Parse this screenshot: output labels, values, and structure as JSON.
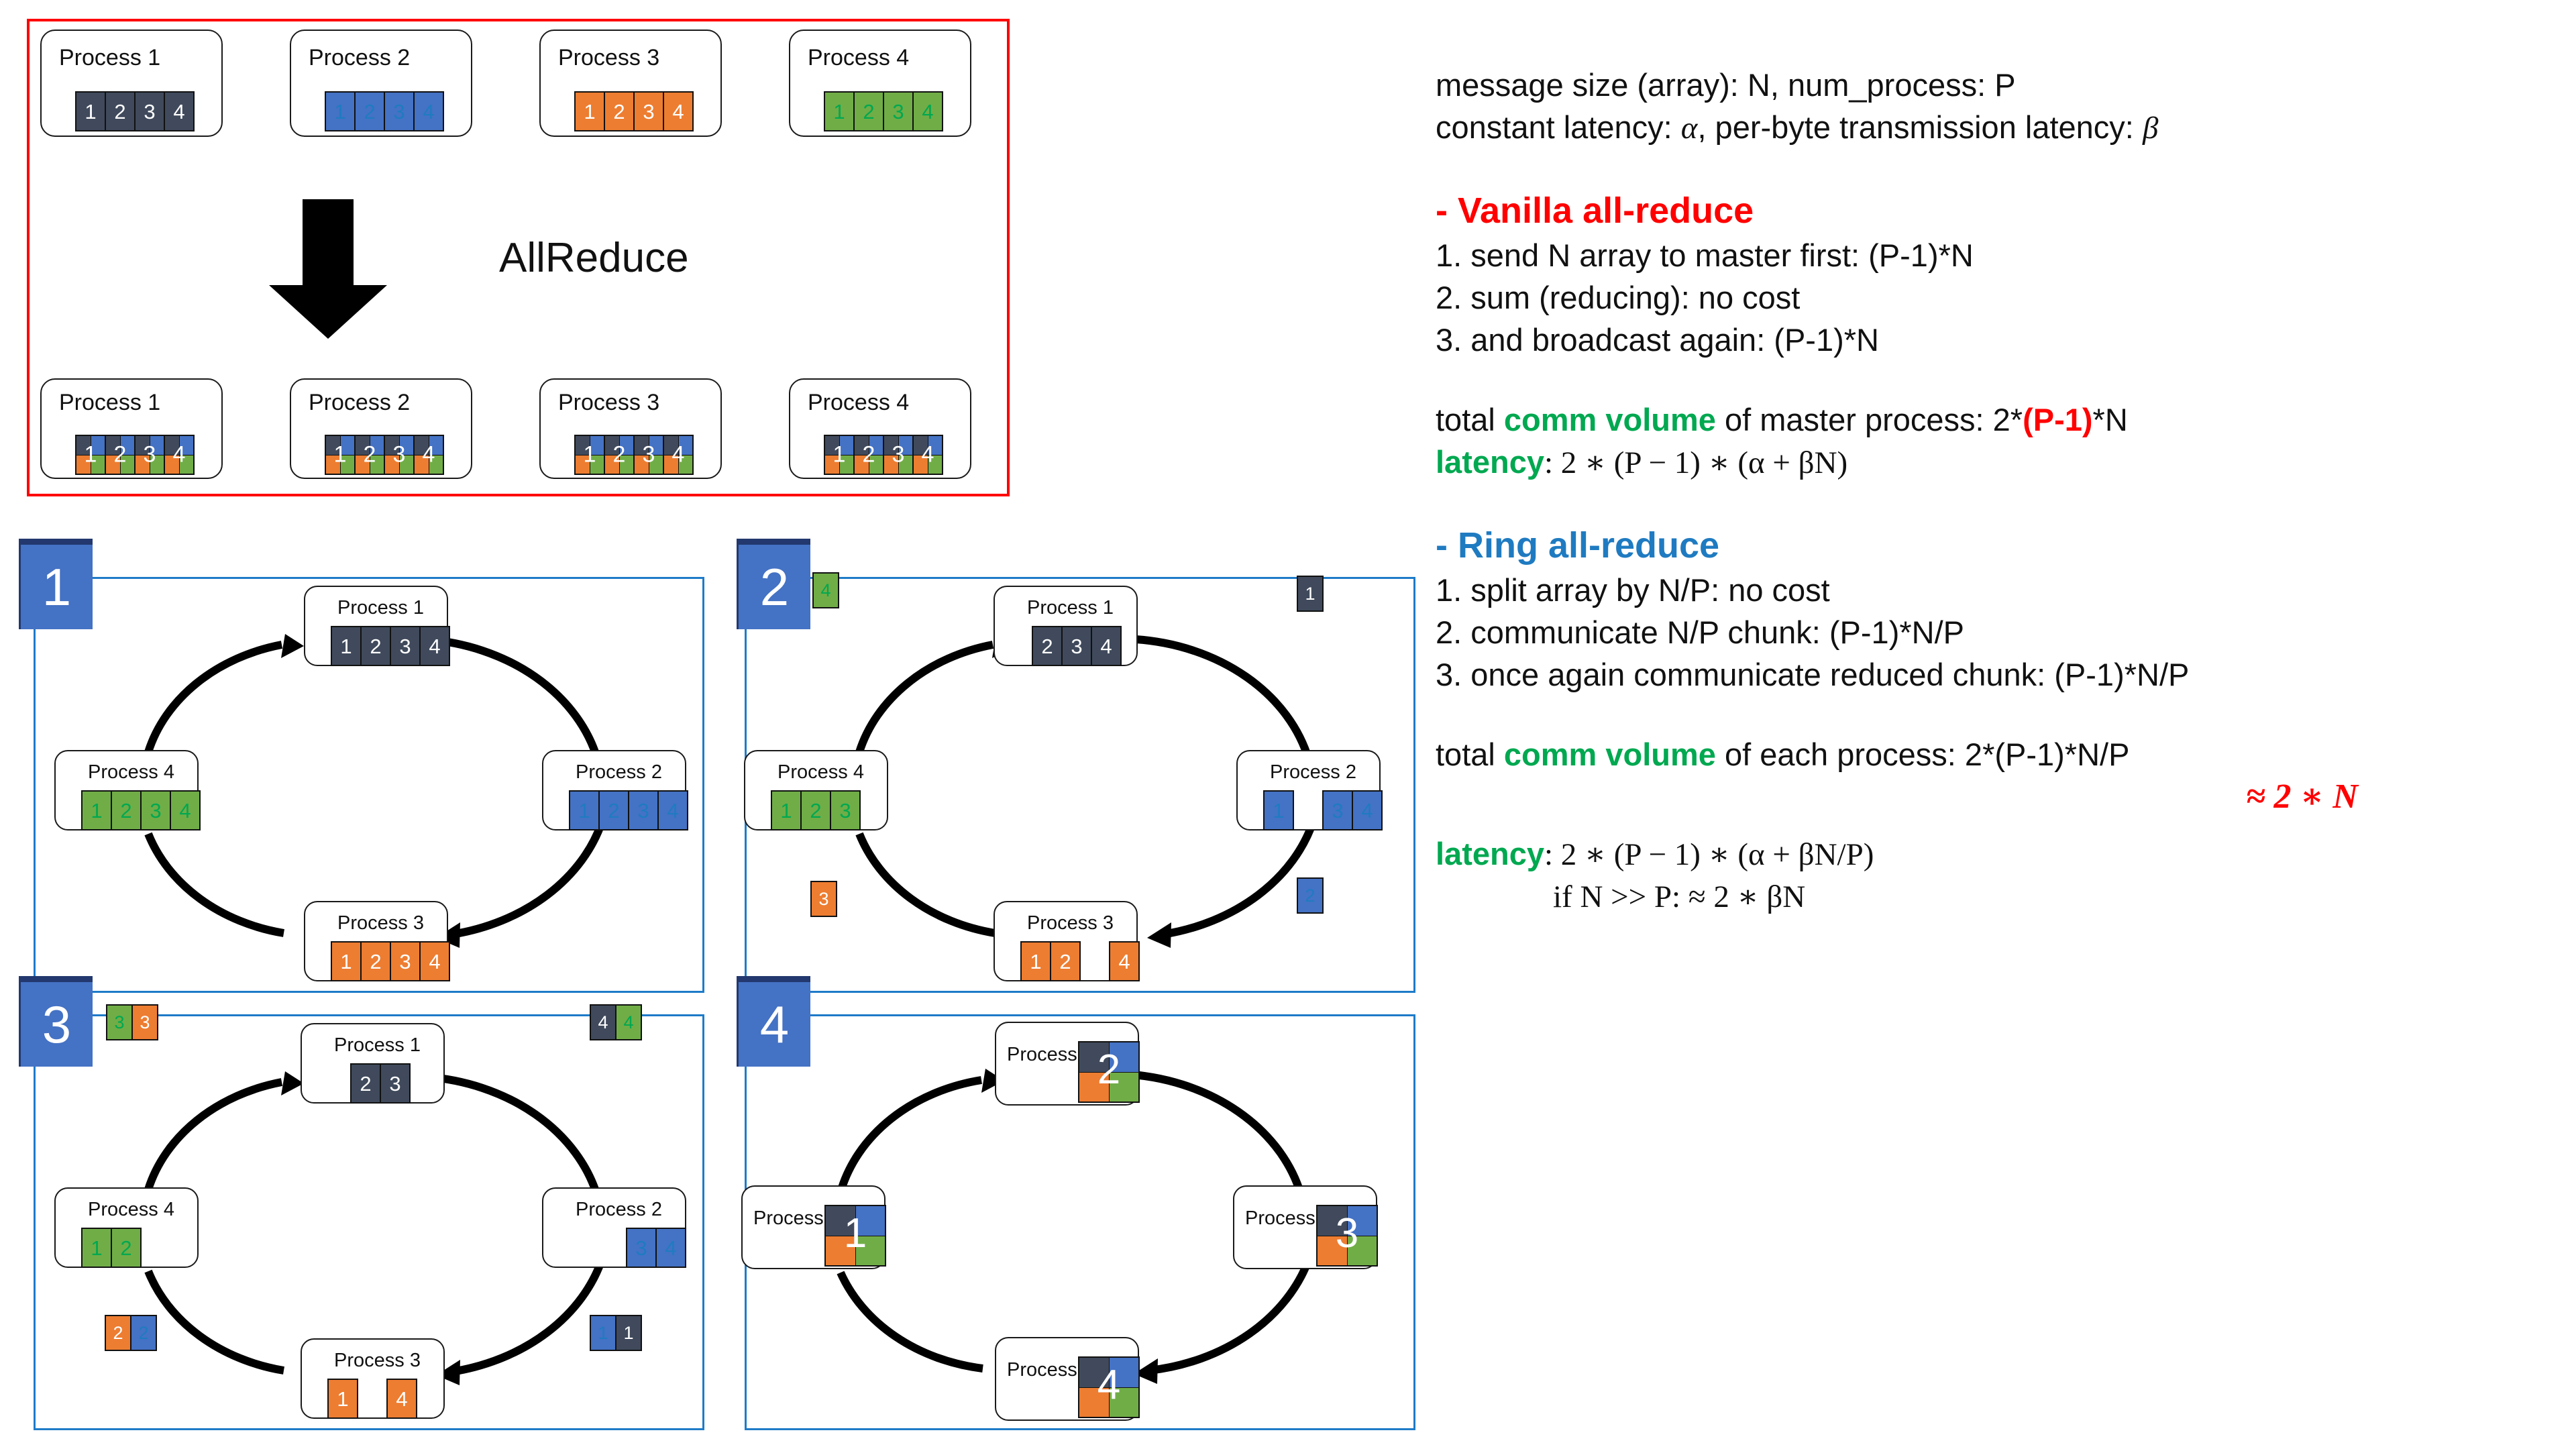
{
  "colors": {
    "dark": "#404A5C",
    "blue": "#4472C4",
    "orange": "#ED7D31",
    "green": "#70AD47",
    "red_border": "#FF0000",
    "panel_border": "#1E7BC8",
    "badge_blue": "#4472C4",
    "accent_green_text": "#00A850",
    "accent_red_text": "#FF0000",
    "accent_blue_text": "#1F7BC1"
  },
  "allreduce": {
    "label": "AllReduce",
    "arrow_icon": "down-arrow-icon",
    "top_row": [
      {
        "title": "Process 1",
        "color": "dark",
        "cells": [
          "1",
          "2",
          "3",
          "4"
        ]
      },
      {
        "title": "Process 2",
        "color": "blue",
        "cells": [
          "1",
          "2",
          "3",
          "4"
        ]
      },
      {
        "title": "Process 3",
        "color": "orange",
        "cells": [
          "1",
          "2",
          "3",
          "4"
        ]
      },
      {
        "title": "Process 4",
        "color": "green",
        "cells": [
          "1",
          "2",
          "3",
          "4"
        ]
      }
    ],
    "bottom_row": [
      {
        "title": "Process 1",
        "cells": [
          "1",
          "2",
          "3",
          "4"
        ]
      },
      {
        "title": "Process 2",
        "cells": [
          "1",
          "2",
          "3",
          "4"
        ]
      },
      {
        "title": "Process 3",
        "cells": [
          "1",
          "2",
          "3",
          "4"
        ]
      },
      {
        "title": "Process 4",
        "cells": [
          "1",
          "2",
          "3",
          "4"
        ]
      }
    ]
  },
  "panels": [
    {
      "badge": "1",
      "processes": {
        "p1": {
          "title": "Process 1",
          "color": "dark",
          "cells": [
            "1",
            "2",
            "3",
            "4"
          ]
        },
        "p2": {
          "title": "Process 2",
          "color": "blue",
          "cells": [
            "1",
            "2",
            "3",
            "4"
          ]
        },
        "p3": {
          "title": "Process 3",
          "color": "orange",
          "cells": [
            "1",
            "2",
            "3",
            "4"
          ]
        },
        "p4": {
          "title": "Process 4",
          "color": "green",
          "cells": [
            "1",
            "2",
            "3",
            "4"
          ]
        }
      },
      "floating": []
    },
    {
      "badge": "2",
      "processes": {
        "p1": {
          "title": "Process 1",
          "color": "dark",
          "cells": [
            "2",
            "3",
            "4"
          ]
        },
        "p2": {
          "title": "Process 2",
          "color": "blue",
          "cells": [
            "1",
            "",
            "3",
            "4"
          ]
        },
        "p3": {
          "title": "Process 3",
          "color": "orange",
          "cells": [
            "1",
            "2",
            "",
            "4"
          ]
        },
        "p4": {
          "title": "Process 4",
          "color": "green",
          "cells": [
            "1",
            "2",
            "3"
          ]
        }
      },
      "floating": [
        {
          "pos": "top-left",
          "items": [
            {
              "color": "green",
              "label": "4"
            }
          ]
        },
        {
          "pos": "top-right",
          "items": [
            {
              "color": "dark",
              "label": "1"
            }
          ]
        },
        {
          "pos": "bottom-left",
          "items": [
            {
              "color": "orange",
              "label": "3"
            }
          ]
        },
        {
          "pos": "bottom-right",
          "items": [
            {
              "color": "blue",
              "label": "2"
            }
          ]
        }
      ]
    },
    {
      "badge": "3",
      "processes": {
        "p1": {
          "title": "Process 1",
          "color": "dark",
          "cells": [
            "2",
            "3"
          ]
        },
        "p2": {
          "title": "Process 2",
          "color": "blue",
          "cells": [
            "3",
            "4"
          ]
        },
        "p3": {
          "title": "Process 3",
          "color": "orange",
          "cells": [
            "1",
            "",
            "4"
          ]
        },
        "p4": {
          "title": "Process 4",
          "color": "green",
          "cells": [
            "1",
            "2"
          ]
        }
      },
      "floating": [
        {
          "pos": "top-left",
          "items": [
            {
              "color": "green",
              "label": "3"
            },
            {
              "color": "orange",
              "label": "3"
            }
          ]
        },
        {
          "pos": "top-right",
          "items": [
            {
              "color": "dark",
              "label": "4"
            },
            {
              "color": "green",
              "label": "4"
            }
          ]
        },
        {
          "pos": "bottom-left",
          "items": [
            {
              "color": "orange",
              "label": "2"
            },
            {
              "color": "blue",
              "label": "2"
            }
          ]
        },
        {
          "pos": "bottom-right",
          "items": [
            {
              "color": "blue",
              "label": "1"
            },
            {
              "color": "dark",
              "label": "1"
            }
          ]
        }
      ]
    },
    {
      "badge": "4",
      "processes": {
        "p1": {
          "title": "Process 1",
          "quad": "2"
        },
        "p2": {
          "title": "Process 2",
          "quad": "3"
        },
        "p3": {
          "title": "Process 3",
          "quad": "4"
        },
        "p4": {
          "title": "Process 4",
          "quad": "1"
        }
      },
      "floating": []
    }
  ],
  "notes": {
    "defs_line1": "message size (array): N, num_process: P",
    "defs_line2_a": "constant latency: ",
    "defs_line2_alpha": "α",
    "defs_line2_b": ", per-byte transmission latency: ",
    "defs_line2_beta": "β",
    "vanilla": {
      "heading": "- Vanilla all-reduce",
      "step1": "1. send N array to master first: (P-1)*N",
      "step2": "2. sum (reducing): no cost",
      "step3": "3. and broadcast again: (P-1)*N",
      "volume_pre": "total ",
      "volume_accent": "comm volume",
      "volume_mid": " of master process: 2*",
      "volume_red": "(P-1)",
      "volume_post": "*N",
      "latency_label": "latency",
      "latency_formula": ": 2 ∗ (P − 1) ∗ (α + βN)"
    },
    "ring": {
      "heading": "- Ring all-reduce",
      "step1": "1. split array by N/P: no cost",
      "step2": "2. communicate N/P chunk: (P-1)*N/P",
      "step3": "3. once again communicate reduced chunk: (P-1)*N/P",
      "volume_pre": "total ",
      "volume_accent": "comm volume",
      "volume_post": " of each process: 2*(P-1)*N/P",
      "approx": "≈ 2 ∗ N",
      "latency_label": "latency",
      "latency_formula": ": 2 ∗ (P − 1) ∗ (α + βN/P)",
      "latency_note": "if N >> P: ≈ 2 ∗ βN"
    }
  }
}
